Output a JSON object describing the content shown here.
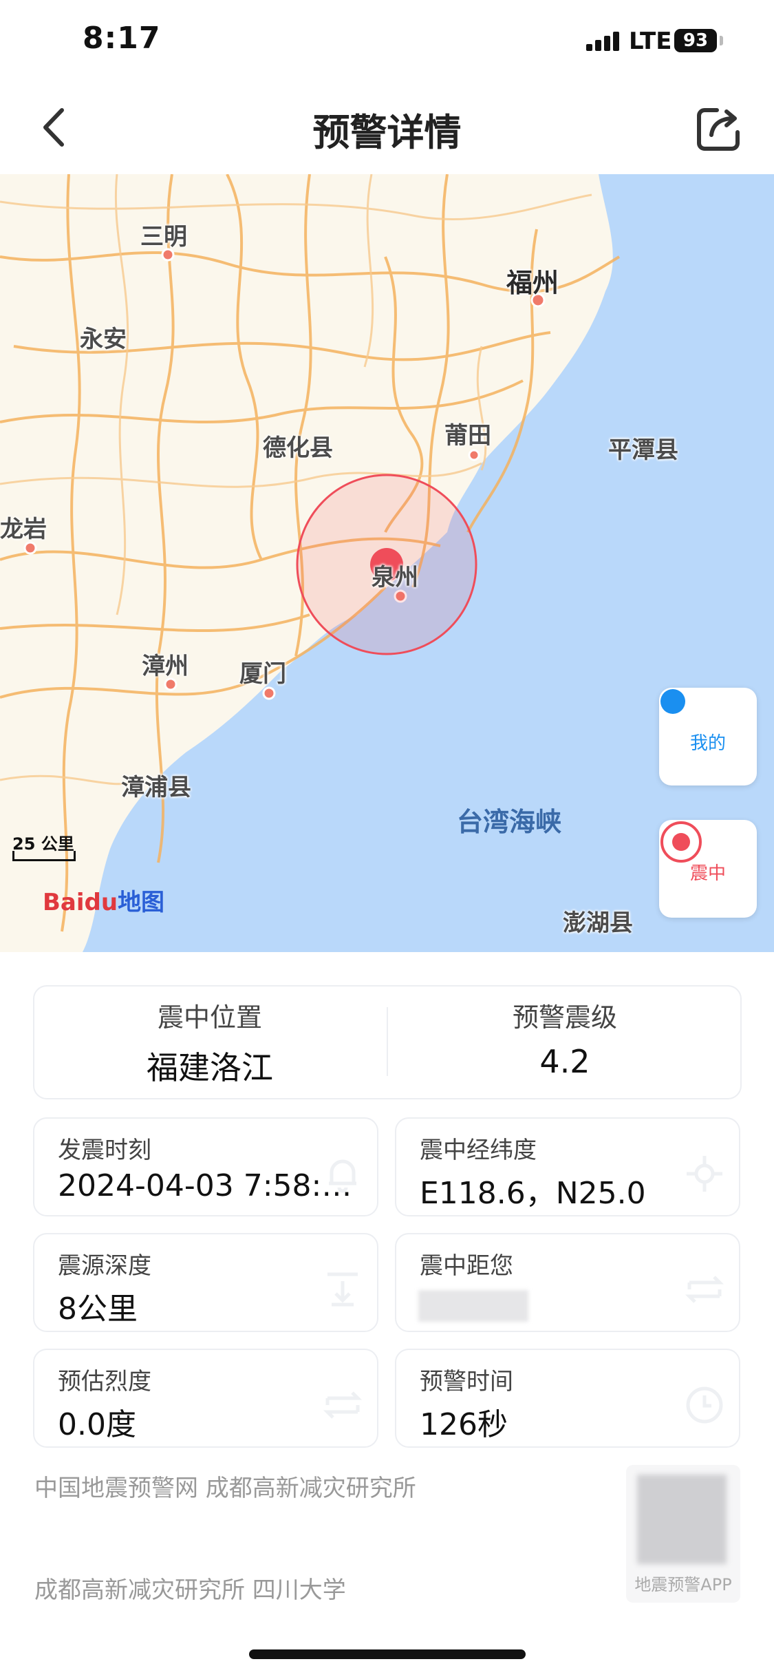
{
  "status_bar": {
    "time": "8:17",
    "network": "LTE",
    "battery": "93"
  },
  "nav": {
    "title": "预警详情",
    "back_icon": "chevron-left-icon",
    "share_icon": "share-icon"
  },
  "map": {
    "labels": {
      "sanming": "三明",
      "yongan": "永安",
      "fuzhou": "福州",
      "dehua": "德化县",
      "putian": "莆田",
      "pingtan": "平潭县",
      "longyan": "龙岩",
      "quanzhou": "泉州",
      "zhangzhou": "漳州",
      "xiamen": "厦门",
      "zhangpu": "漳浦县",
      "strait": "台湾海峡",
      "penghu": "澎湖县"
    },
    "scale": "25 公里",
    "logo": "Baidu地图",
    "buttons": {
      "mine": "我的",
      "epicenter": "震中"
    },
    "colors": {
      "land": "#fbf7ec",
      "sea": "#b9d8fa",
      "road": "#f4b25e",
      "epicenter": "#ef4d5a",
      "mine_dot": "#1a8ff0"
    }
  },
  "info": {
    "location_label": "震中位置",
    "location_value": "福建洛江",
    "magnitude_label": "预警震级",
    "magnitude_value": "4.2",
    "time_label": "发震时刻",
    "time_value": "2024-04-03 7:58:5...",
    "coord_label": "震中经纬度",
    "coord_value": "E118.6，N25.0",
    "depth_label": "震源深度",
    "depth_value": "8公里",
    "distance_label": "震中距您",
    "intensity_label": "预估烈度",
    "intensity_value": "0.0度",
    "warning_label": "预警时间",
    "warning_value": "126秒"
  },
  "footer": {
    "line1": "中国地震预警网 成都高新减灾研究所",
    "line2": "成都高新减灾研究所 四川大学",
    "qr_label": "地震预警APP"
  }
}
